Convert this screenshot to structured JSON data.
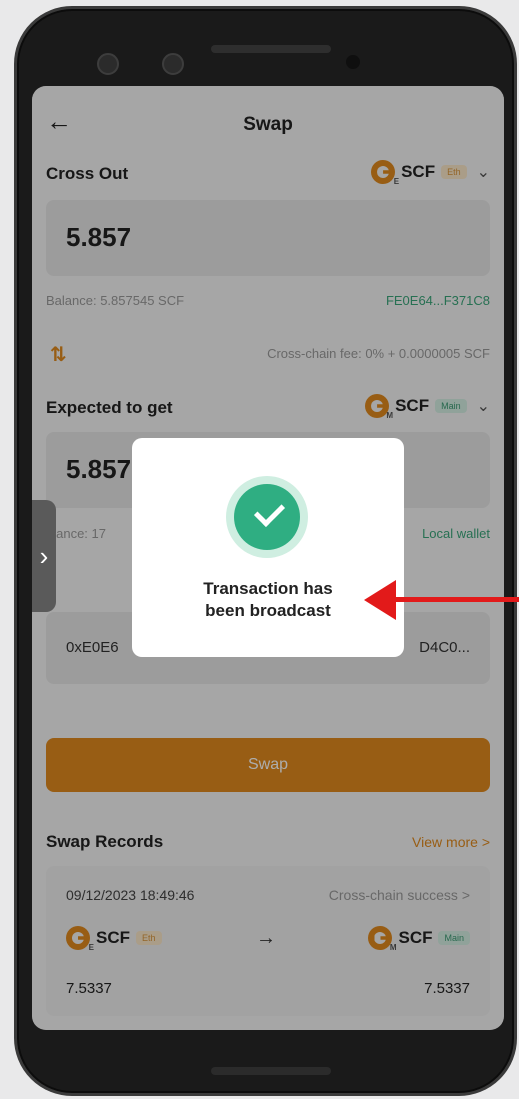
{
  "nav": {
    "back_icon": "arrow-left-icon",
    "title": "Swap"
  },
  "cross_out": {
    "label": "Cross Out",
    "token": {
      "name": "SCF",
      "badge": "Eth",
      "sub": "E"
    },
    "amount": "5.857",
    "balance": "Balance: 5.857545 SCF",
    "address": "FE0E64...F371C8"
  },
  "fee": {
    "icon": "swap-vertical-icon",
    "text": "Cross-chain fee: 0% + 0.0000005 SCF"
  },
  "expected": {
    "label": "Expected to get",
    "token": {
      "name": "SCF",
      "badge": "Main",
      "sub": "M"
    },
    "amount": "5.857",
    "balance": "alance: 17",
    "wallet": "Local wallet",
    "address_left": "0xE0E6",
    "address_right": "D4C0..."
  },
  "swap_button": "Swap",
  "records": {
    "title": "Swap Records",
    "view_more": "View more >",
    "item": {
      "date": "09/12/2023 18:49:46",
      "status": "Cross-chain success >",
      "from_token": "SCF",
      "from_badge": "Eth",
      "to_token": "SCF",
      "to_badge": "Main",
      "arrow": "→",
      "from_amount": "7.5337",
      "to_amount": "7.5337"
    }
  },
  "side_tab": "›",
  "modal": {
    "message_line1": "Transaction has",
    "message_line2": "been broadcast"
  },
  "colors": {
    "accent": "#e08a1e",
    "success": "#2fae82",
    "annotation": "#e21a1a"
  }
}
